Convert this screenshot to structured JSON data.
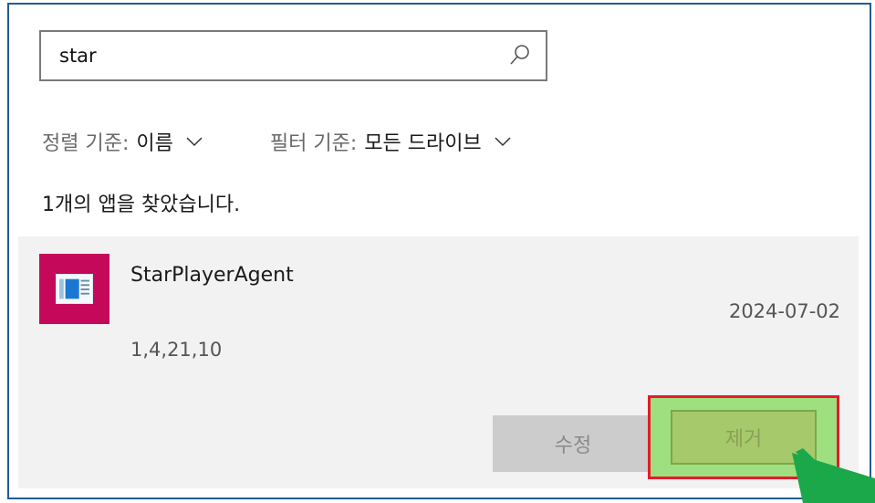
{
  "search": {
    "value": "star",
    "placeholder": ""
  },
  "filters": {
    "sort_label": "정렬 기준:",
    "sort_value": "이름",
    "filter_label": "필터 기준:",
    "filter_value": "모든 드라이브"
  },
  "results": {
    "count_text": "1개의 앱을 찾았습니다."
  },
  "app": {
    "name": "StarPlayerAgent",
    "date": "2024-07-02",
    "version": "1,4,21,10",
    "icon": "app-window-icon",
    "tile_color": "#c4095b"
  },
  "buttons": {
    "modify": "수정",
    "remove": "제거"
  },
  "colors": {
    "highlight_border": "#e8192c",
    "highlight_fill": "#9ee07f",
    "arrow": "#1aa84a"
  }
}
